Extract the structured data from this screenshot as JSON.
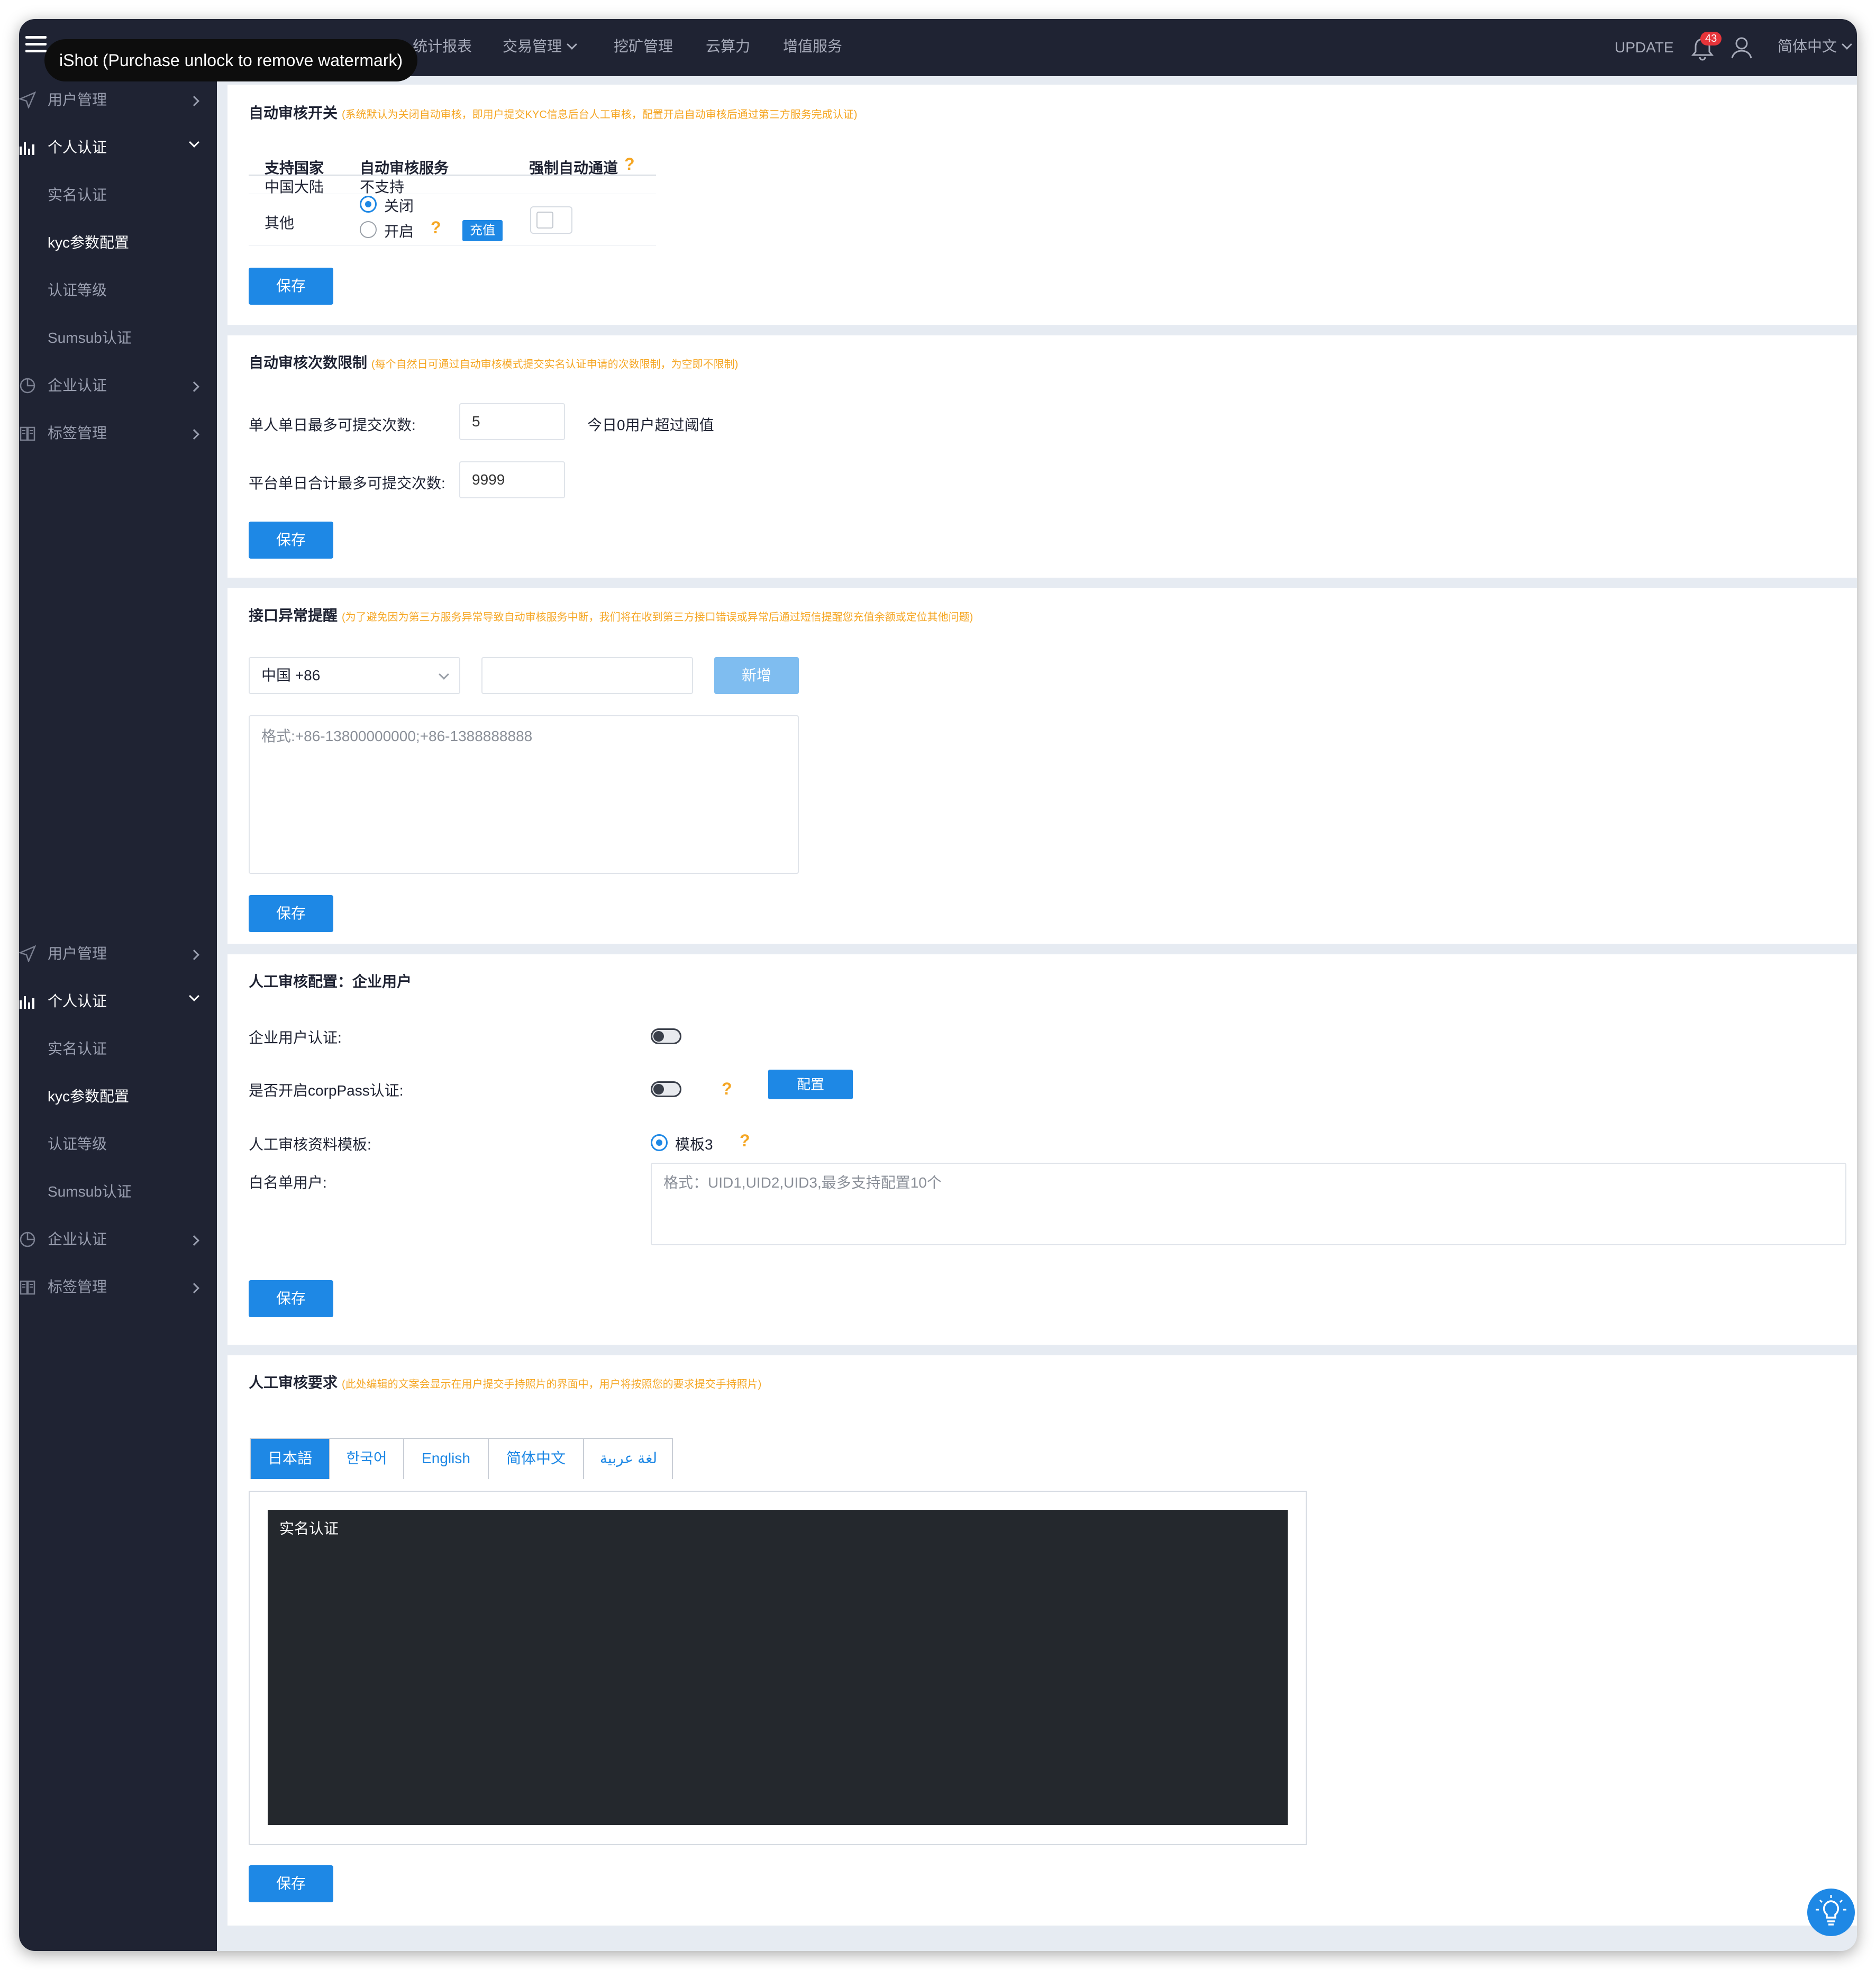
{
  "watermark": "iShot (Purchase unlock to remove watermark)",
  "topnav": {
    "items": [
      "统计报表",
      "交易管理",
      "挖矿管理",
      "云算力",
      "增值服务"
    ],
    "update": "UPDATE",
    "badge": "43",
    "language": "简体中文"
  },
  "sidebar": {
    "user_mgmt": "用户管理",
    "personal_kyc": "个人认证",
    "real_name": "实名认证",
    "kyc_config": "kyc参数配置",
    "kyc_level": "认证等级",
    "sumsub": "Sumsub认证",
    "enterprise": "企业认证",
    "tags": "标签管理"
  },
  "section_auto": {
    "title": "自动审核开关",
    "note": "(系统默认为关闭自动审核，即用户提交KYC信息后台人工审核，配置开启自动审核后通过第三方服务完成认证)",
    "col_country": "支持国家",
    "col_service": "自动审核服务",
    "col_force": "强制自动通道",
    "row1_country": "中国大陆",
    "row1_service": "不支持",
    "row2_country": "其他",
    "radio_off": "关闭",
    "radio_on": "开启",
    "recharge": "充值",
    "save": "保存"
  },
  "section_limit": {
    "title": "自动审核次数限制",
    "note": "(每个自然日可通过自动审核模式提交实名认证申请的次数限制，为空即不限制)",
    "per_user_label": "单人单日最多可提交次数:",
    "per_user_value": "5",
    "exceed_text": "今日0用户超过阈值",
    "platform_label": "平台单日合计最多可提交次数:",
    "platform_value": "9999",
    "save": "保存"
  },
  "section_alert": {
    "title": "接口异常提醒",
    "note": "(为了避免因为第三方服务异常导致自动审核服务中断，我们将在收到第三方接口错误或异常后通过短信提醒您充值余额或定位其他问题)",
    "country_select": "中国 +86",
    "add": "新增",
    "textarea_placeholder": "格式:+86-13800000000;+86-1388888888",
    "save": "保存"
  },
  "section_manual": {
    "title": "人工审核配置：企业用户",
    "enterprise_label": "企业用户认证:",
    "corppass_label": "是否开启corpPass认证:",
    "config": "配置",
    "template_label": "人工审核资料模板:",
    "template_value": "模板3",
    "whitelist_label": "白名单用户:",
    "whitelist_placeholder": "格式：UID1,UID2,UID3,最多支持配置10个",
    "save": "保存"
  },
  "section_req": {
    "title": "人工审核要求",
    "note": "(此处编辑的文案会显示在用户提交手持照片的界面中，用户将按照您的要求提交手持照片)",
    "tabs": [
      "日本語",
      "한국어",
      "English",
      "简体中文",
      "لغة عربية"
    ],
    "editor_text": "实名认证",
    "save": "保存"
  },
  "colors": {
    "sidebar_bg": "#1f2333",
    "primary": "#1e88e5",
    "note": "#f5a623",
    "badge": "#e6343a"
  },
  "icons": [
    "menu-icon",
    "bell-icon",
    "user-icon",
    "send-icon",
    "bar-chart-icon",
    "pie-icon",
    "book-icon",
    "question-icon",
    "lightbulb-icon",
    "chevron-down-icon",
    "chevron-right-icon"
  ]
}
